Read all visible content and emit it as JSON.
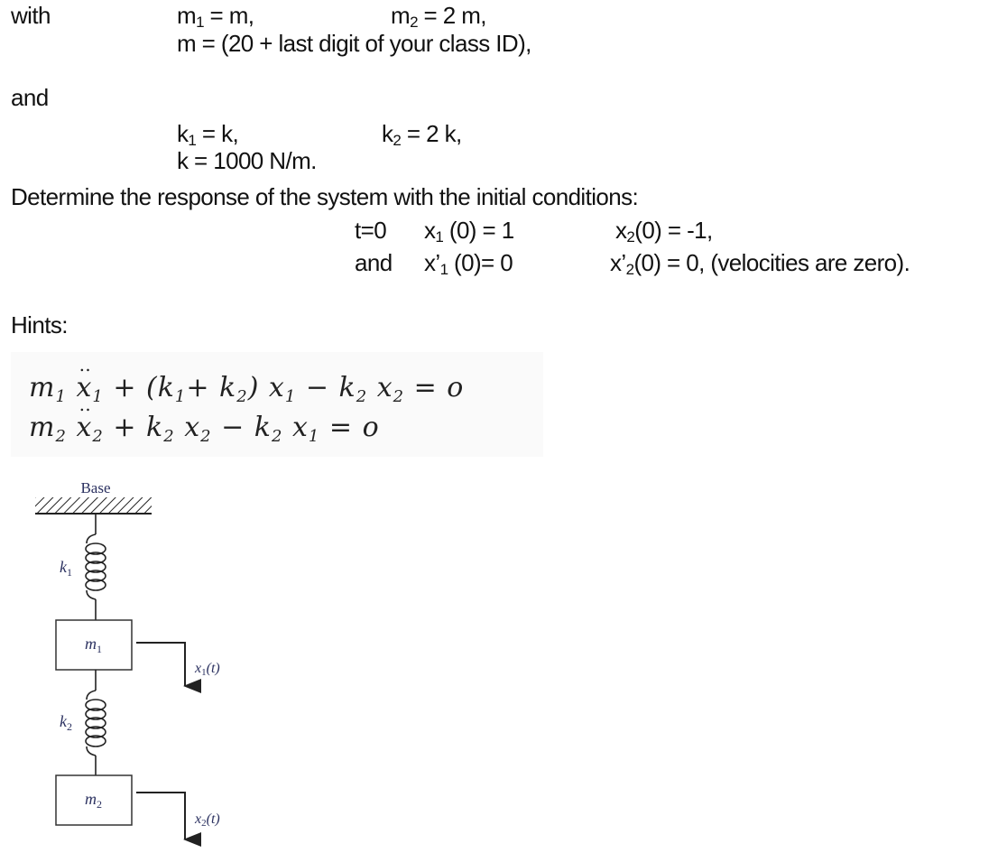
{
  "given": {
    "with_label": "with",
    "m1": {
      "sym": "m",
      "sub": "1",
      "rest": " = m,"
    },
    "m2": {
      "sym": "m",
      "sub": "2",
      "rest": " = 2 m,"
    },
    "m_def": "m = (20 + last digit of your class ID),",
    "and_label": "and",
    "k1": {
      "sym": "k",
      "sub": "1",
      "rest": " = k,"
    },
    "k2": {
      "sym": "k",
      "sub": "2",
      "rest": " = 2 k,"
    },
    "k_def": "k = 1000 N/m."
  },
  "task": {
    "prompt": "Determine the response of the system with the initial conditions:",
    "row1": {
      "t_label": "t=0",
      "x1": {
        "pre": "x",
        "sub": "1",
        "post": " (0) = 1"
      },
      "x2": {
        "pre": "x",
        "sub": "2",
        "post": "(0) = -1,"
      }
    },
    "row2": {
      "and_label": "and",
      "v1": {
        "pre": "x’",
        "sub": "1",
        "post": " (0)= 0"
      },
      "v2": {
        "pre": "x’",
        "sub": "2",
        "post": "(0) = 0, (velocities are zero)."
      }
    }
  },
  "hints": {
    "label": "Hints:",
    "eq1": {
      "m": "m",
      "m_sub": "1",
      "x": "x",
      "x_sub": "1",
      "mid": " + (k",
      "k1_sub": "1",
      "plus": "+ k",
      "k2_sub": "2",
      "close": ") x",
      "x1_sub": "1",
      "minus": " −  k",
      "k2b_sub": "2",
      "x2": " x",
      "x2_sub": "2",
      "eq": " =  o"
    },
    "eq2": {
      "m": "m",
      "m_sub": "2",
      "x": "x",
      "x_sub": "2",
      "plus": " +  k",
      "k2_sub": "2",
      "x2": " x",
      "x2_sub": "2",
      "minus": "  −  k",
      "k2b_sub": "2",
      "x1": " x",
      "x1_sub": "1",
      "eq": "    =  o"
    }
  },
  "diagram": {
    "base_label": "Base",
    "k1_label": "k",
    "k1_sub": "1",
    "k2_label": "k",
    "k2_sub": "2",
    "m1_label": "m",
    "m1_sub": "1",
    "m2_label": "m",
    "m2_sub": "2",
    "x1_label": "x",
    "x1_sub": "1",
    "x1_arg": "(t)",
    "x2_label": "x",
    "x2_sub": "2",
    "x2_arg": "(t)",
    "label_color": "#2b3160"
  }
}
